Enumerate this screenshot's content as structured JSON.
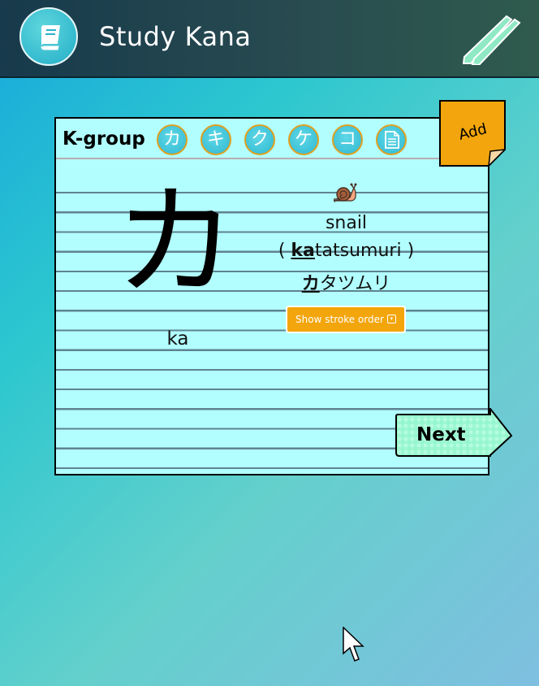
{
  "header": {
    "title": "Study Kana",
    "logo_icon": "book-icon",
    "menu_icon": "pencils-icon"
  },
  "card": {
    "group_title": "K-group",
    "kana_buttons": [
      "カ",
      "キ",
      "ク",
      "ケ",
      "コ"
    ],
    "list_icon": "document-icon",
    "current_kana": "カ",
    "romaji": "ka",
    "emoji": "snail-icon",
    "word_english": "snail",
    "reading": {
      "open": "( ",
      "highlight": "ka",
      "rest": "tatsumuri",
      "close": " )"
    },
    "katakana_word": {
      "highlight": "カ",
      "rest": "タツムリ"
    },
    "stroke_order_label": "Show stroke order",
    "add_label": "Add",
    "next_label": "Next"
  },
  "colors": {
    "card_bg": "#b2fefe",
    "accent_orange": "#f3a50c",
    "button_teal": "#2fb8d2",
    "header_dark": "#173a4c"
  }
}
